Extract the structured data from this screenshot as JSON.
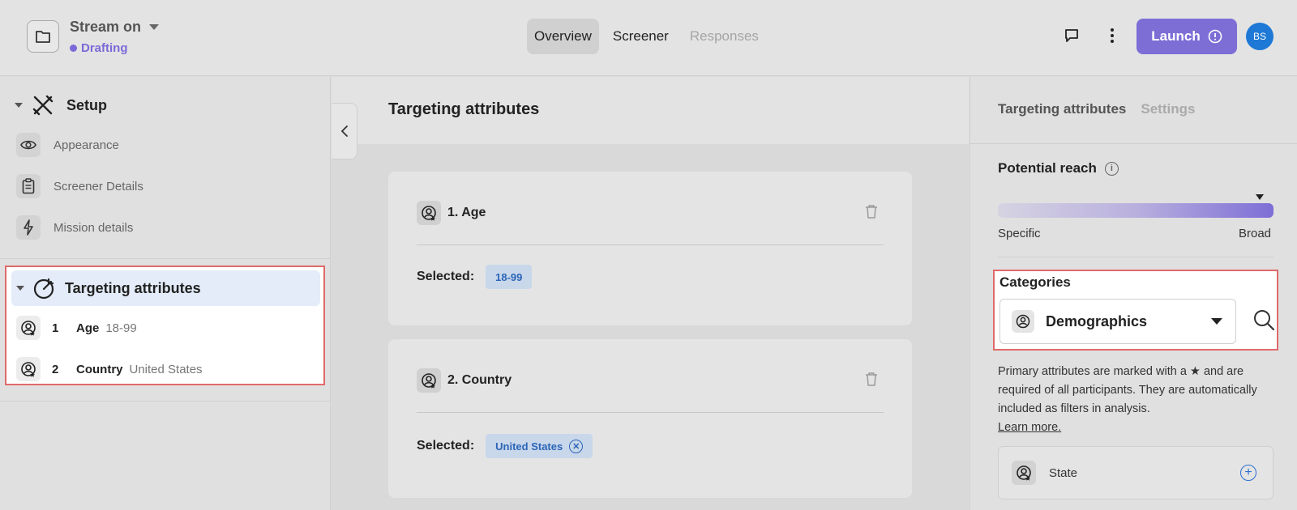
{
  "header": {
    "project_title": "Stream on",
    "status": "Drafting",
    "tabs": [
      {
        "label": "Overview",
        "state": "active"
      },
      {
        "label": "Screener",
        "state": "normal"
      },
      {
        "label": "Responses",
        "state": "disabled"
      }
    ],
    "launch_label": "Launch",
    "avatar_initials": "BS",
    "accent_color": "#7d6ed6"
  },
  "sidebar": {
    "setup": {
      "title": "Setup",
      "items": [
        {
          "label": "Appearance",
          "icon": "eye-icon"
        },
        {
          "label": "Screener Details",
          "icon": "clipboard-icon"
        },
        {
          "label": "Mission details",
          "icon": "lightning-icon"
        }
      ]
    },
    "targeting": {
      "title": "Targeting attributes",
      "items": [
        {
          "num": "1",
          "name": "Age",
          "value": "18-99"
        },
        {
          "num": "2",
          "name": "Country",
          "value": "United States"
        }
      ]
    }
  },
  "main": {
    "title": "Targeting attributes",
    "cards": [
      {
        "title": "1. Age",
        "selected_label": "Selected:",
        "chip": "18-99"
      },
      {
        "title": "2. Country",
        "selected_label": "Selected:",
        "chip": "United States"
      }
    ]
  },
  "right_panel": {
    "tabs": [
      {
        "label": "Targeting attributes",
        "state": "active"
      },
      {
        "label": "Settings",
        "state": "inactive"
      }
    ],
    "reach": {
      "title": "Potential reach",
      "low_label": "Specific",
      "high_label": "Broad",
      "level": 0.95
    },
    "categories": {
      "title": "Categories",
      "selected": "Demographics"
    },
    "help_text": "Primary attributes are marked with a ★ and are required of all participants. They are automatically included as filters in analysis.",
    "learn_more": "Learn more.",
    "attribute_item": "State"
  }
}
